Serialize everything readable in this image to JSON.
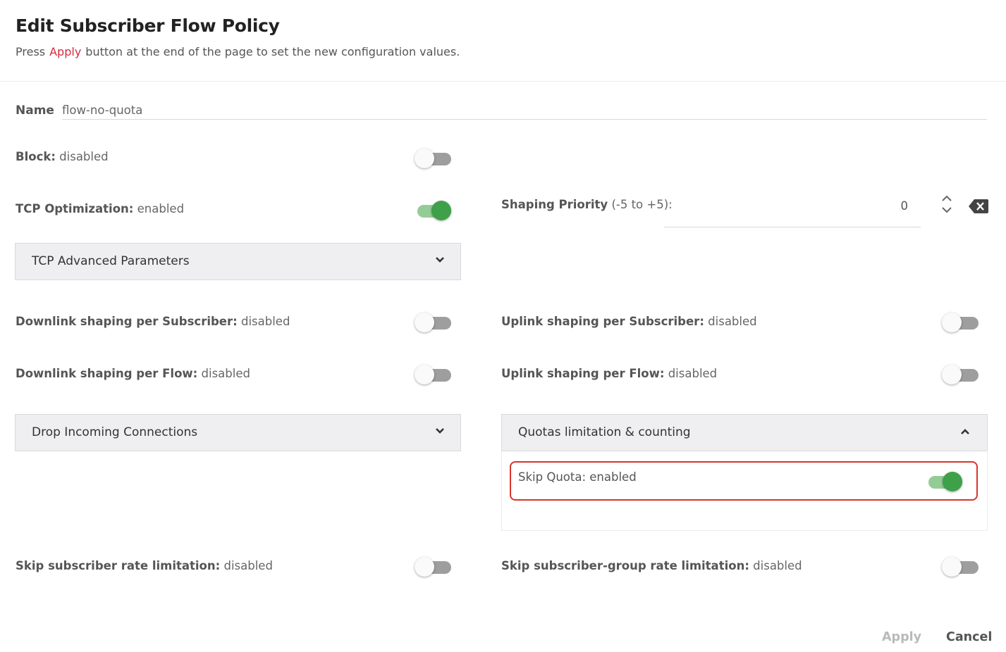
{
  "header": {
    "title": "Edit Subscriber Flow Policy",
    "subtitle_prefix": "Press",
    "subtitle_highlight": "Apply",
    "subtitle_suffix": "button at the end of the page to set the new configuration values."
  },
  "name": {
    "label": "Name",
    "value": "flow-no-quota"
  },
  "block": {
    "label": "Block:",
    "state": "disabled",
    "on": false
  },
  "tcp_optimization": {
    "label": "TCP Optimization:",
    "state": "enabled",
    "on": true
  },
  "shaping_priority": {
    "label_bold": "Shaping Priority",
    "label_range": "(-5 to +5):",
    "value": "0"
  },
  "tcp_advanced": {
    "title": "TCP Advanced Parameters",
    "expanded": false
  },
  "downlink_subscriber": {
    "label": "Downlink shaping per Subscriber:",
    "state": "disabled",
    "on": false
  },
  "uplink_subscriber": {
    "label": "Uplink shaping per Subscriber:",
    "state": "disabled",
    "on": false
  },
  "downlink_flow": {
    "label": "Downlink shaping per Flow:",
    "state": "disabled",
    "on": false
  },
  "uplink_flow": {
    "label": "Uplink shaping per Flow:",
    "state": "disabled",
    "on": false
  },
  "drop_incoming": {
    "title": "Drop Incoming Connections",
    "expanded": false
  },
  "quotas": {
    "title": "Quotas limitation & counting",
    "expanded": true,
    "skip_quota": {
      "label": "Skip Quota:",
      "state": "enabled",
      "on": true
    }
  },
  "skip_subscriber_rate": {
    "label": "Skip subscriber rate limitation:",
    "state": "disabled",
    "on": false
  },
  "skip_group_rate": {
    "label": "Skip subscriber-group rate limitation:",
    "state": "disabled",
    "on": false
  },
  "footer": {
    "apply_label": "Apply",
    "cancel_label": "Cancel"
  },
  "colors": {
    "accent_red": "#d6293f",
    "toggle_on": "#3fa04a",
    "highlight_border": "#d9342b"
  }
}
